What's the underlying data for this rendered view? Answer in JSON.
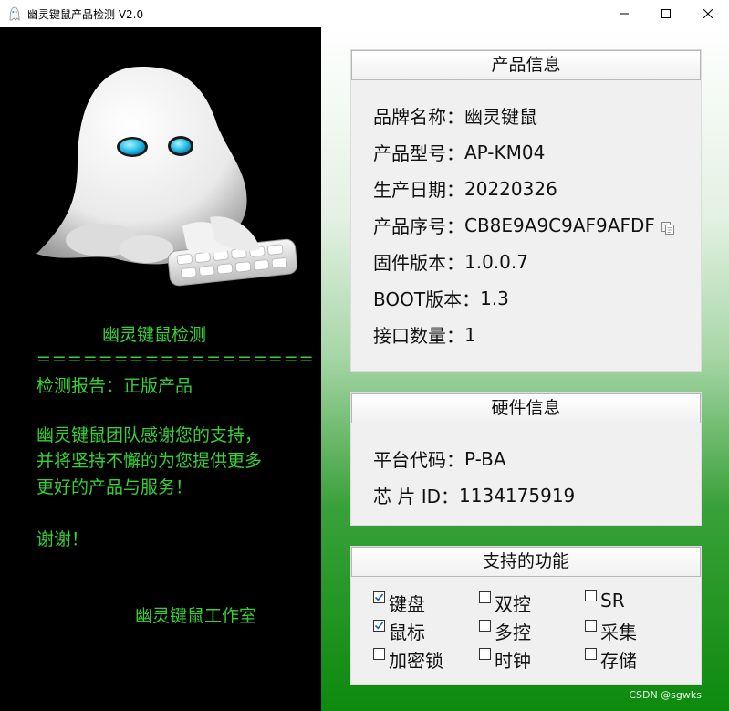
{
  "window": {
    "title": "幽灵键鼠产品检测 V2.0"
  },
  "terminal": {
    "heading": "幽灵键鼠检测",
    "divider": "==================",
    "report": "检测报告：正版产品",
    "thanks_line1": "幽灵键鼠团队感谢您的支持，",
    "thanks_line2": "并将坚持不懈的为您提供更多",
    "thanks_line3": "更好的产品与服务！",
    "bye": "谢谢！",
    "signature": "幽灵键鼠工作室"
  },
  "product_info": {
    "title": "产品信息",
    "rows": [
      {
        "label": "品牌名称：",
        "value": "幽灵键鼠"
      },
      {
        "label": "产品型号：",
        "value": "AP-KM04"
      },
      {
        "label": "生产日期：",
        "value": "20220326"
      },
      {
        "label": "产品序号：",
        "value": "CB8E9A9C9AF9AFDF"
      },
      {
        "label": "固件版本：",
        "value": "1.0.0.7"
      },
      {
        "label": "BOOT版本：",
        "value": "1.3"
      },
      {
        "label": "接口数量：",
        "value": "1"
      }
    ]
  },
  "hardware_info": {
    "title": "硬件信息",
    "rows": [
      {
        "label": "平台代码：",
        "value": "P-BA"
      },
      {
        "label": "芯 片  ID：",
        "value": "1134175919"
      }
    ]
  },
  "features": {
    "title": "支持的功能",
    "items": [
      {
        "label": "键盘",
        "checked": true
      },
      {
        "label": "双控",
        "checked": false
      },
      {
        "label": "SR",
        "checked": false
      },
      {
        "label": "鼠标",
        "checked": true
      },
      {
        "label": "多控",
        "checked": false
      },
      {
        "label": "采集",
        "checked": false
      },
      {
        "label": "加密锁",
        "checked": false
      },
      {
        "label": "时钟",
        "checked": false
      },
      {
        "label": "存储",
        "checked": false
      }
    ]
  },
  "watermark": "CSDN @sgwks"
}
